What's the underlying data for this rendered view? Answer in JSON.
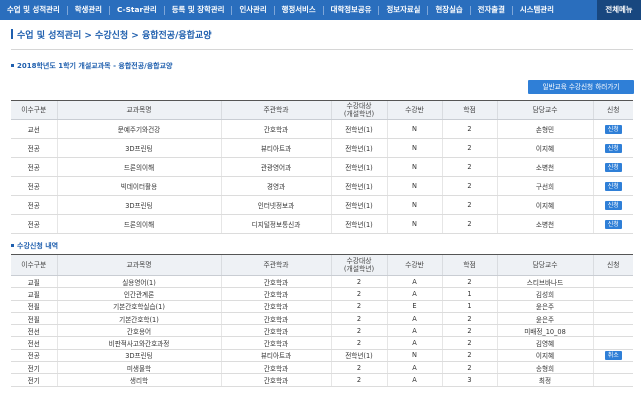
{
  "nav": {
    "items": [
      "수업 및 성적관리",
      "학생관리",
      "C-Star관리",
      "등록 및 장학관리",
      "인사관리",
      "행정서비스",
      "대학정보공유",
      "정보자료실",
      "현장실습",
      "전자출결",
      "시스템관리"
    ],
    "all_menu": "전체메뉴"
  },
  "breadcrumb": "수업 및 성적관리 > 수강신청 > 융합전공/융합교양",
  "section1": {
    "title": "2018학년도 1학기 개설교과목 - 융합전공/융합교양",
    "action_button": "일반교육 수강신청 하러가기",
    "headers": [
      "이수구분",
      "교과목명",
      "주관학과",
      "수강대상\n(개설학년)",
      "수강반",
      "학점",
      "담당교수",
      "신청"
    ],
    "rows": [
      [
        "교선",
        "문예주기와건강",
        "간호학과",
        "전학년(1)",
        "N",
        "2",
        "손형민",
        "신청"
      ],
      [
        "전공",
        "3D프린팅",
        "뷰티아트과",
        "전학년(1)",
        "N",
        "2",
        "이지혜",
        "신청"
      ],
      [
        "전공",
        "드론의이해",
        "관광영어과",
        "전학년(1)",
        "N",
        "2",
        "소병천",
        "신청"
      ],
      [
        "전공",
        "빅데이터활용",
        "경영과",
        "전학년(1)",
        "N",
        "2",
        "구선희",
        "신청"
      ],
      [
        "전공",
        "3D프린팅",
        "인터넷정보과",
        "전학년(1)",
        "N",
        "2",
        "이지혜",
        "신청"
      ],
      [
        "전공",
        "드론의이해",
        "디지털정보통신과",
        "전학년(1)",
        "N",
        "2",
        "소병천",
        "신청"
      ]
    ]
  },
  "section2": {
    "title": "수강신청 내역",
    "headers": [
      "이수구분",
      "교과목명",
      "주관학과",
      "수강대상\n(개설학년)",
      "수강반",
      "학점",
      "담당교수",
      "신청"
    ],
    "rows": [
      [
        "교필",
        "실용영어(1)",
        "간호학과",
        "2",
        "A",
        "2",
        "스티브바나드",
        ""
      ],
      [
        "교필",
        "인간관계론",
        "간호학과",
        "2",
        "A",
        "1",
        "김성희",
        ""
      ],
      [
        "전필",
        "기본간호학실습(1)",
        "간호학과",
        "2",
        "E",
        "1",
        "윤은주",
        ""
      ],
      [
        "전필",
        "기본간호학(1)",
        "간호학과",
        "2",
        "A",
        "2",
        "윤은주",
        ""
      ],
      [
        "전선",
        "간호용어",
        "간호학과",
        "2",
        "A",
        "2",
        "미배정_10_08",
        ""
      ],
      [
        "전선",
        "비판적사고와간호과정",
        "간호학과",
        "2",
        "A",
        "2",
        "김영혜",
        ""
      ],
      [
        "전공",
        "3D프린팅",
        "뷰티아트과",
        "전학년(1)",
        "N",
        "2",
        "이지혜",
        "취소"
      ],
      [
        "전기",
        "미생물학",
        "간호학과",
        "2",
        "A",
        "2",
        "송형희",
        ""
      ],
      [
        "전기",
        "생리학",
        "간호학과",
        "2",
        "A",
        "3",
        "최정",
        ""
      ]
    ]
  }
}
